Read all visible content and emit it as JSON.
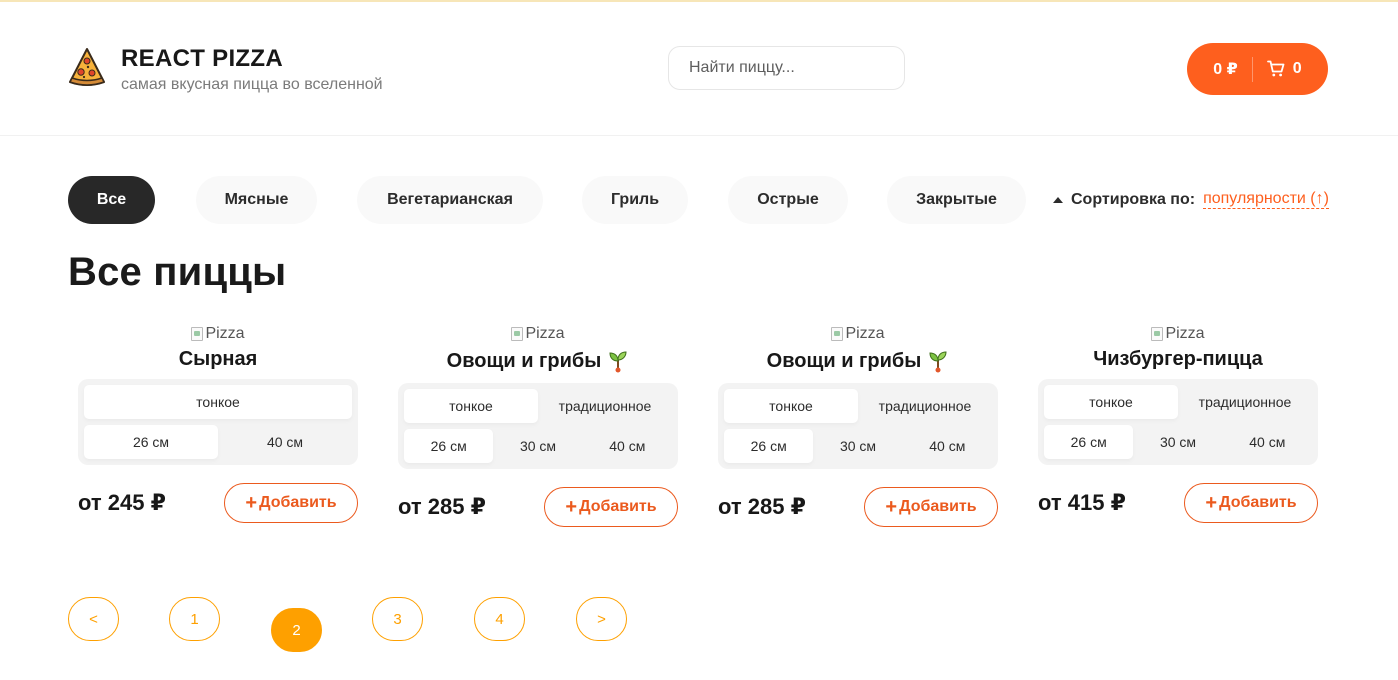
{
  "header": {
    "title": "REACT PIZZA",
    "subtitle": "самая вкусная пицца во вселенной",
    "search_placeholder": "Найти пиццу...",
    "cart_total": "0 ₽",
    "cart_count": "0"
  },
  "categories": [
    "Все",
    "Мясные",
    "Вегетарианская",
    "Гриль",
    "Острые",
    "Закрытые"
  ],
  "active_category": "Все",
  "sort": {
    "label": "Сортировка по:",
    "value": "популярности (↑)"
  },
  "page_title": "Все пиццы",
  "pizzas": [
    {
      "img_alt": "Pizza",
      "title": "Сырная",
      "vegetarian": false,
      "types": [
        "тонкое"
      ],
      "active_type": "тонкое",
      "sizes": [
        "26 см",
        "40 см"
      ],
      "active_size": "26 см",
      "price": "от 245 ₽",
      "add_label": "Добавить"
    },
    {
      "img_alt": "Pizza",
      "title": "Овощи и грибы",
      "vegetarian": true,
      "types": [
        "тонкое",
        "традиционное"
      ],
      "active_type": "тонкое",
      "sizes": [
        "26 см",
        "30 см",
        "40 см"
      ],
      "active_size": "26 см",
      "price": "от 285 ₽",
      "add_label": "Добавить"
    },
    {
      "img_alt": "Pizza",
      "title": "Овощи и грибы",
      "vegetarian": true,
      "types": [
        "тонкое",
        "традиционное"
      ],
      "active_type": "тонкое",
      "sizes": [
        "26 см",
        "30 см",
        "40 см"
      ],
      "active_size": "26 см",
      "price": "от 285 ₽",
      "add_label": "Добавить"
    },
    {
      "img_alt": "Pizza",
      "title": "Чизбургер-пицца",
      "vegetarian": false,
      "types": [
        "тонкое",
        "традиционное"
      ],
      "active_type": "тонкое",
      "sizes": [
        "26 см",
        "30 см",
        "40 см"
      ],
      "active_size": "26 см",
      "price": "от 415 ₽",
      "add_label": "Добавить"
    }
  ],
  "pagination": {
    "prev": "<",
    "pages": [
      "1",
      "2",
      "3",
      "4"
    ],
    "active_page": "2",
    "next": ">"
  },
  "colors": {
    "accent": "#fe5f1e",
    "pagination": "#fea000",
    "dark": "#282828"
  }
}
